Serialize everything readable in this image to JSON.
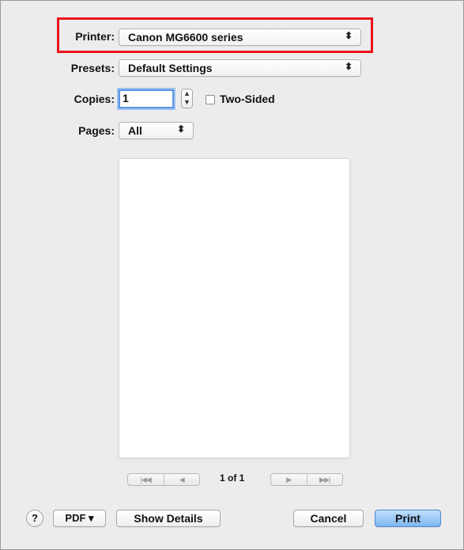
{
  "printer": {
    "label": "Printer:",
    "value": "Canon MG6600 series"
  },
  "presets": {
    "label": "Presets:",
    "value": "Default Settings"
  },
  "copies": {
    "label": "Copies:",
    "value": "1",
    "two_sided_label": "Two-Sided",
    "two_sided_checked": false
  },
  "pages": {
    "label": "Pages:",
    "value": "All"
  },
  "popup_arrows": "⬍",
  "preview": {
    "first_icon": "|◀◀",
    "prev_icon": "◀",
    "next_icon": "▶",
    "last_icon": "▶▶|",
    "page_count": "1 of 1"
  },
  "footer": {
    "help": "?",
    "pdf": "PDF ▾",
    "show_details": "Show Details",
    "cancel": "Cancel",
    "print": "Print"
  },
  "colors": {
    "highlight": "#e8141b",
    "default_button": "#7fb6f1",
    "focus_ring": "#5b95e3"
  }
}
